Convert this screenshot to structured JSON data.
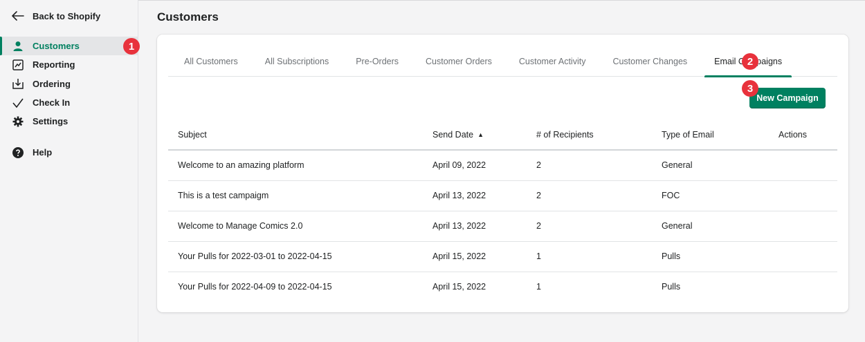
{
  "sidebar": {
    "back_label": "Back to Shopify",
    "items": [
      {
        "label": "Customers",
        "icon": "person-icon",
        "active": true
      },
      {
        "label": "Reporting",
        "icon": "report-icon"
      },
      {
        "label": "Ordering",
        "icon": "download-icon"
      },
      {
        "label": "Check In",
        "icon": "checkmark-icon"
      },
      {
        "label": "Settings",
        "icon": "gear-icon"
      }
    ],
    "help_label": "Help"
  },
  "annotations": [
    "1",
    "2",
    "3"
  ],
  "page": {
    "title": "Customers"
  },
  "tabs": [
    {
      "label": "All Customers"
    },
    {
      "label": "All Subscriptions"
    },
    {
      "label": "Pre-Orders"
    },
    {
      "label": "Customer Orders"
    },
    {
      "label": "Customer Activity"
    },
    {
      "label": "Customer Changes"
    },
    {
      "label": "Email Campaigns",
      "active": true
    }
  ],
  "new_campaign_label": "New Campaign",
  "table": {
    "headers": [
      "Subject",
      "Send Date",
      "# of Recipients",
      "Type of Email",
      "Actions"
    ],
    "sort_indicator": "▲",
    "rows": [
      [
        "Welcome to an amazing platform",
        "April 09, 2022",
        "2",
        "General",
        ""
      ],
      [
        "This is a test campaigm",
        "April 13, 2022",
        "2",
        "FOC",
        ""
      ],
      [
        "Welcome to Manage Comics 2.0",
        "April 13, 2022",
        "2",
        "General",
        ""
      ],
      [
        "Your Pulls for 2022-03-01 to 2022-04-15",
        "April 15, 2022",
        "1",
        "Pulls",
        ""
      ],
      [
        "Your Pulls for 2022-04-09 to 2022-04-15",
        "April 15, 2022",
        "1",
        "Pulls",
        ""
      ]
    ]
  },
  "colors": {
    "accent": "#008060",
    "badge": "#e8323c"
  }
}
